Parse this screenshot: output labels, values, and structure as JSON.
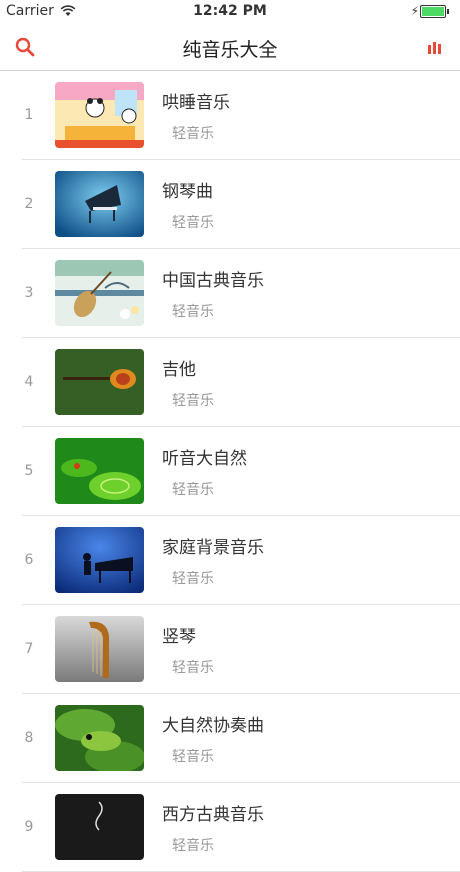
{
  "status": {
    "carrier": "Carrier",
    "time": "12:42 PM"
  },
  "nav": {
    "title": "纯音乐大全"
  },
  "colors": {
    "accent": "#e64a3b"
  },
  "items": [
    {
      "index": "1",
      "title": "哄睡音乐",
      "subtitle": "轻音乐"
    },
    {
      "index": "2",
      "title": "钢琴曲",
      "subtitle": "轻音乐"
    },
    {
      "index": "3",
      "title": "中国古典音乐",
      "subtitle": "轻音乐"
    },
    {
      "index": "4",
      "title": "吉他",
      "subtitle": "轻音乐"
    },
    {
      "index": "5",
      "title": "听音大自然",
      "subtitle": "轻音乐"
    },
    {
      "index": "6",
      "title": "家庭背景音乐",
      "subtitle": "轻音乐"
    },
    {
      "index": "7",
      "title": "竖琴",
      "subtitle": "轻音乐"
    },
    {
      "index": "8",
      "title": "大自然协奏曲",
      "subtitle": "轻音乐"
    },
    {
      "index": "9",
      "title": "西方古典音乐",
      "subtitle": "轻音乐"
    }
  ]
}
